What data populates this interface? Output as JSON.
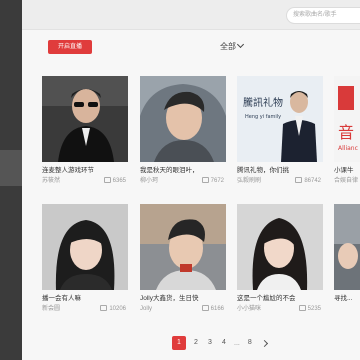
{
  "header": {
    "search_placeholder": "搜索歌曲名/歌手"
  },
  "toolbar": {
    "start_live_label": "开启直播",
    "filter_label": "全部"
  },
  "cards": [
    {
      "title": "连麦整人游戏环节",
      "owner": "苏筱然",
      "views": "6365"
    },
    {
      "title": "我是秋天的眼泪叶，",
      "owner": "柳小珂",
      "views": "7672"
    },
    {
      "title": "腾讯礼物，你们挑",
      "owner": "弘毅刷刷",
      "views": "86742"
    },
    {
      "title": "小课牛",
      "owner": "合娱自律",
      "views": ""
    },
    {
      "title": "播一会有人嘛",
      "owner": "新会圆",
      "views": "10206"
    },
    {
      "title": "Jolly大鑫货，生日快",
      "owner": "Jolly",
      "views": "6166"
    },
    {
      "title": "这是一个尴尬的不会",
      "owner": "小小猫咪",
      "views": "5235"
    },
    {
      "title": "寻找...",
      "owner": "",
      "views": ""
    }
  ],
  "thumb_texts": {
    "card3": "騰訊礼物",
    "card3_sub": "Heng yi family",
    "card4": "音",
    "card4_sub": "Allianc"
  },
  "pagination": {
    "pages": [
      "1",
      "2",
      "3",
      "4",
      "8"
    ],
    "ellipsis": "...",
    "current": "1"
  }
}
